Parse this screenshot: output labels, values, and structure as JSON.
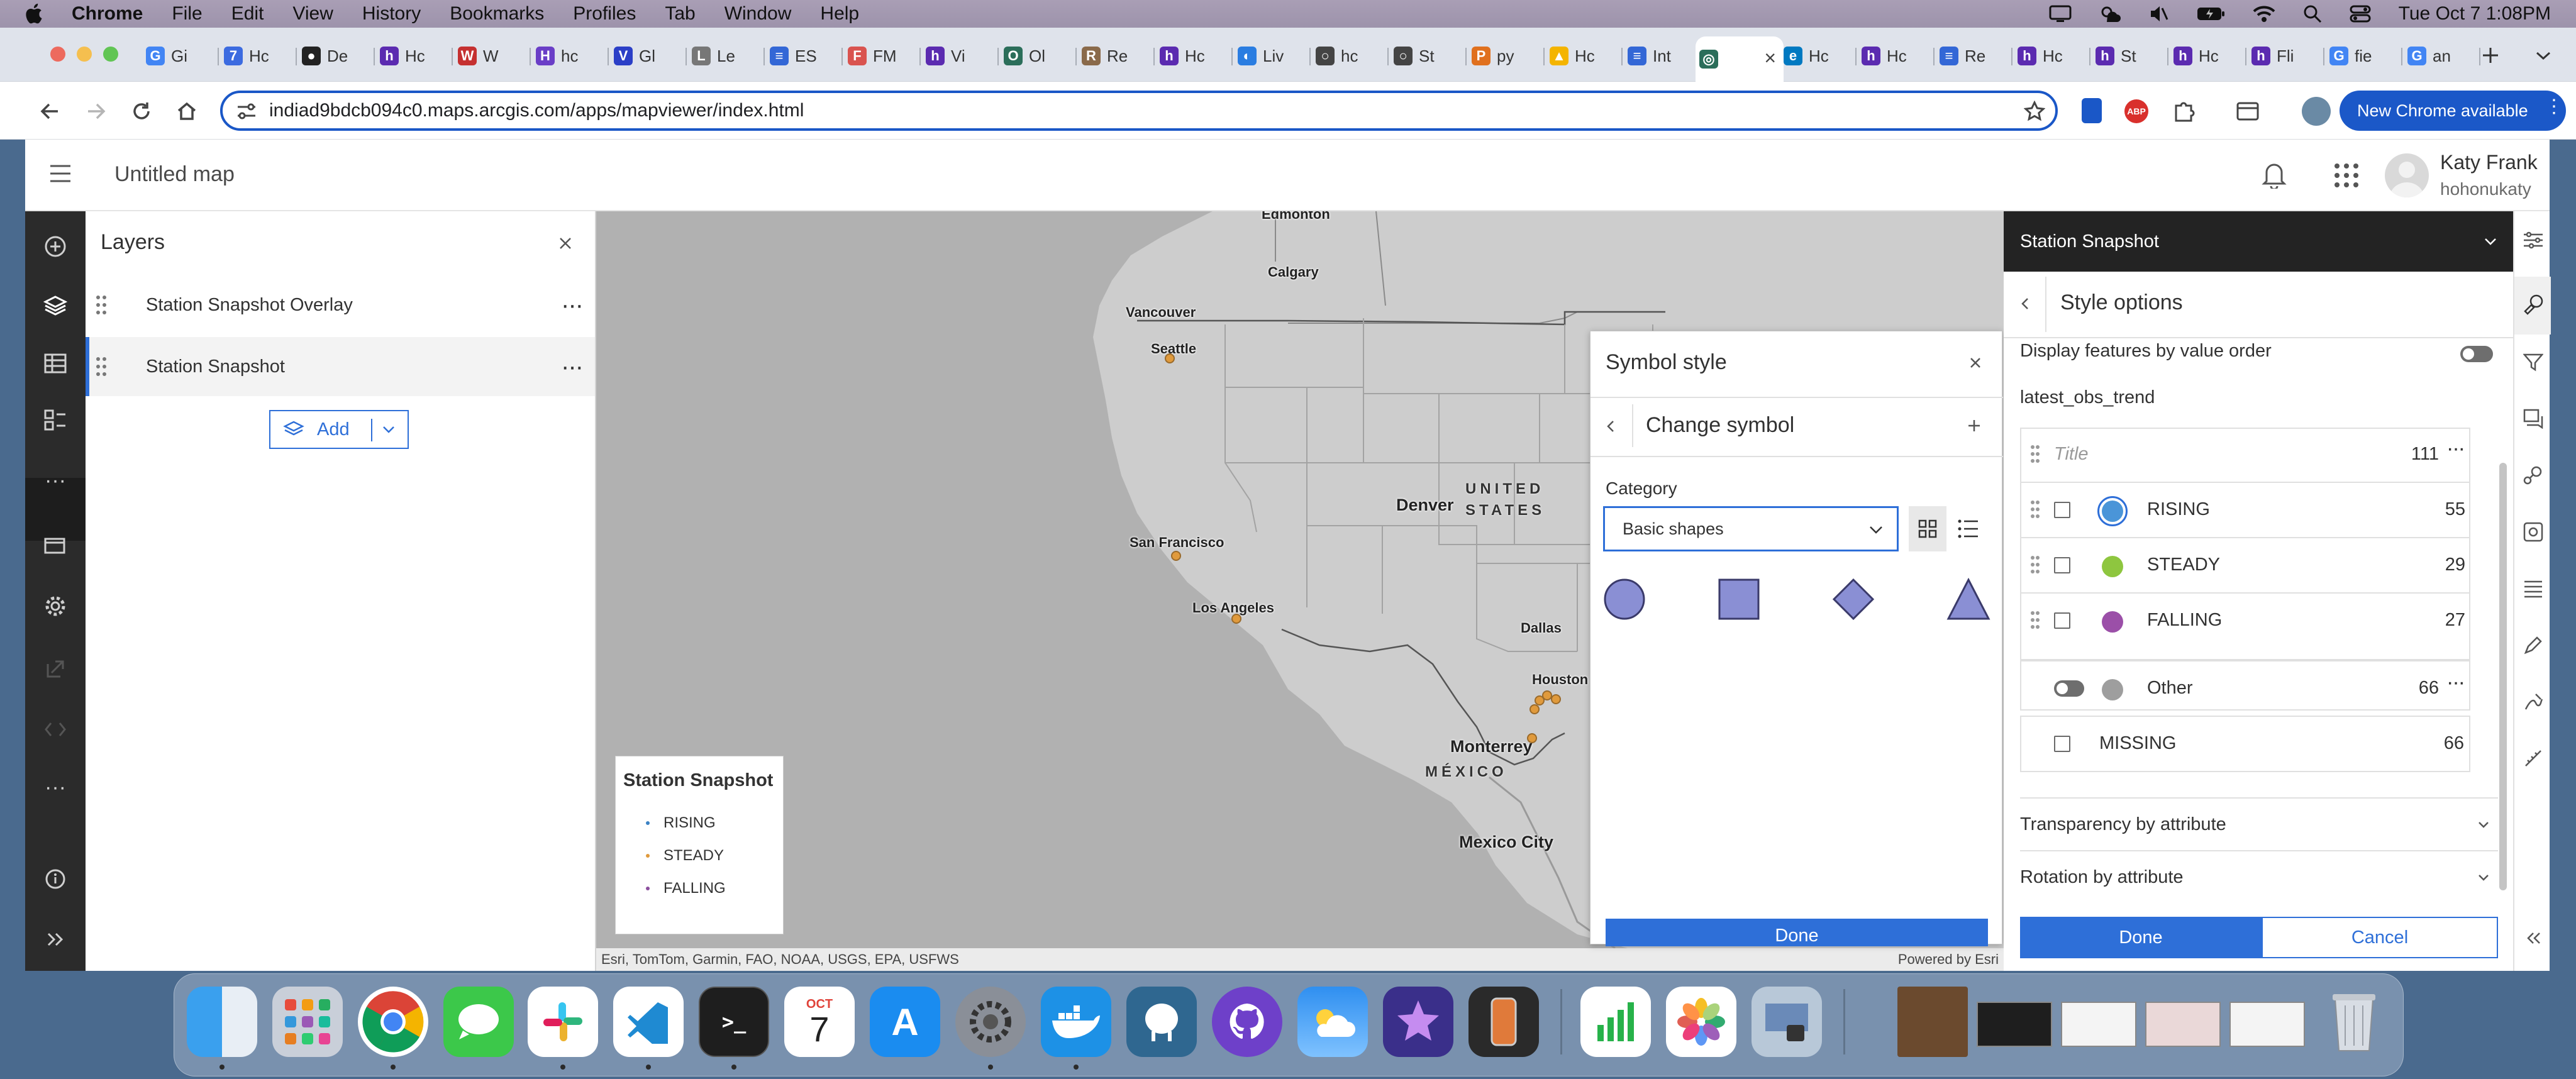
{
  "menubar": {
    "app": "Chrome",
    "items": [
      "File",
      "Edit",
      "View",
      "History",
      "Bookmarks",
      "Profiles",
      "Tab",
      "Window",
      "Help"
    ],
    "clock": "Tue Oct 7  1:08PM"
  },
  "tabs": [
    {
      "label": "Gi",
      "color": "#4285f4",
      "glyph": "G"
    },
    {
      "label": "Hc",
      "color": "#3c6be0",
      "glyph": "7"
    },
    {
      "label": "De",
      "color": "#222222",
      "glyph": "●"
    },
    {
      "label": "Hc",
      "color": "#5b2bb0",
      "glyph": "h"
    },
    {
      "label": "W",
      "color": "#c53030",
      "glyph": "W"
    },
    {
      "label": "hc",
      "color": "#6a3ec7",
      "glyph": "H"
    },
    {
      "label": "Gl",
      "color": "#2b3fc7",
      "glyph": "V"
    },
    {
      "label": "Le",
      "color": "#777777",
      "glyph": "L"
    },
    {
      "label": "ES",
      "color": "#3367d6",
      "glyph": "≡"
    },
    {
      "label": "FM",
      "color": "#d9534f",
      "glyph": "F"
    },
    {
      "label": "Vi",
      "color": "#5b2bb0",
      "glyph": "h"
    },
    {
      "label": "Ol",
      "color": "#2b6e5a",
      "glyph": "O"
    },
    {
      "label": "Re",
      "color": "#8a6a4a",
      "glyph": "R"
    },
    {
      "label": "Hc",
      "color": "#5b2bb0",
      "glyph": "h"
    },
    {
      "label": "Liv",
      "color": "#2a7de1",
      "glyph": "◐"
    },
    {
      "label": "hc",
      "color": "#444444",
      "glyph": "○"
    },
    {
      "label": "St",
      "color": "#444444",
      "glyph": "○"
    },
    {
      "label": "py",
      "color": "#e0701e",
      "glyph": "P"
    },
    {
      "label": "Hc",
      "color": "#f4b400",
      "glyph": "▲"
    },
    {
      "label": "Int",
      "color": "#3367d6",
      "glyph": "≡"
    },
    {
      "label": "",
      "color": "#2b6e5a",
      "glyph": "◎",
      "active": true
    },
    {
      "label": "Hc",
      "color": "#0079c1",
      "glyph": "e"
    },
    {
      "label": "Hc",
      "color": "#5b2bb0",
      "glyph": "h"
    },
    {
      "label": "Re",
      "color": "#3367d6",
      "glyph": "≡"
    },
    {
      "label": "Hc",
      "color": "#5b2bb0",
      "glyph": "h"
    },
    {
      "label": "St",
      "color": "#5b2bb0",
      "glyph": "h"
    },
    {
      "label": "Hc",
      "color": "#5b2bb0",
      "glyph": "h"
    },
    {
      "label": "Fli",
      "color": "#5b2bb0",
      "glyph": "h"
    },
    {
      "label": "fie",
      "color": "#4285f4",
      "glyph": "G"
    },
    {
      "label": "an",
      "color": "#4285f4",
      "glyph": "G"
    }
  ],
  "toolbar": {
    "url": "indiad9bdcb094c0.maps.arcgis.com/apps/mapviewer/index.html",
    "new_chrome": "New Chrome available"
  },
  "app": {
    "map_title": "Untitled map",
    "user_name": "Katy Frank",
    "user_handle": "hohonukaty"
  },
  "layers_panel": {
    "title": "Layers",
    "items": [
      "Station Snapshot Overlay",
      "Station Snapshot"
    ],
    "add_label": "Add"
  },
  "map": {
    "cities": [
      "Edmonton",
      "Calgary",
      "Vancouver",
      "Seattle",
      "San Francisco",
      "Los Angeles",
      "Denver",
      "Dallas",
      "Houston",
      "Monterrey",
      "Mexico City"
    ],
    "regions": [
      "UNITED",
      "STATES",
      "MÉXICO"
    ],
    "attribution": "Esri, TomTom, Garmin, FAO, NOAA, USGS, EPA, USFWS",
    "powered_by": "Powered by Esri",
    "legend": {
      "title": "Station Snapshot",
      "items": [
        {
          "label": "RISING",
          "color": "#3b82c4"
        },
        {
          "label": "STEADY",
          "color": "#e09a3c"
        },
        {
          "label": "FALLING",
          "color": "#8c4f9e"
        }
      ]
    }
  },
  "symbol_style": {
    "title": "Symbol style",
    "subtitle": "Change symbol",
    "category_label": "Category",
    "category_value": "Basic shapes",
    "shape_color": "#8a8fd4",
    "done": "Done"
  },
  "style_panel": {
    "layer_title": "Station Snapshot",
    "heading": "Style options",
    "display_order_label": "Display features by value order",
    "field": "latest_obs_trend",
    "title_placeholder": "Title",
    "title_count": "111",
    "categories": [
      {
        "label": "RISING",
        "count": "55",
        "color": "#4a95d8"
      },
      {
        "label": "STEADY",
        "count": "29",
        "color": "#8ec63f"
      },
      {
        "label": "FALLING",
        "count": "27",
        "color": "#9b4fa8"
      }
    ],
    "other": {
      "label": "Other",
      "count": "66",
      "color": "#9e9e9e"
    },
    "missing": {
      "label": "MISSING",
      "count": "66"
    },
    "transparency": "Transparency by attribute",
    "rotation": "Rotation by attribute",
    "done": "Done",
    "cancel": "Cancel"
  },
  "dock": {
    "calendar_month": "OCT",
    "calendar_day": "7"
  }
}
